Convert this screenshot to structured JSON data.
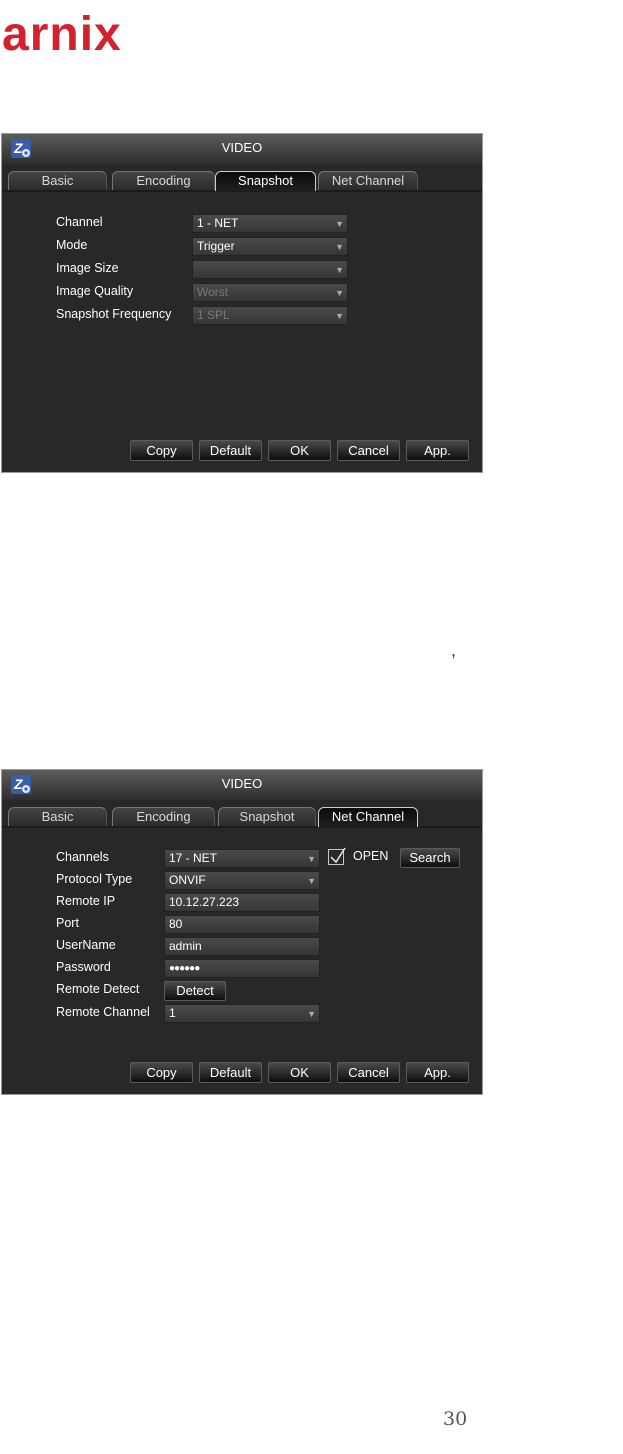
{
  "logo": "arnix",
  "page_number": "30",
  "stray_mark": ",",
  "window1": {
    "title": "VIDEO",
    "tabs": [
      "Basic",
      "Encoding",
      "Snapshot",
      "Net Channel"
    ],
    "active_tab": "Snapshot",
    "fields": {
      "channel": {
        "label": "Channel",
        "value": "1 - NET"
      },
      "mode": {
        "label": "Mode",
        "value": "Trigger"
      },
      "image_size": {
        "label": "Image Size",
        "value": ""
      },
      "image_quality": {
        "label": "Image Quality",
        "value": "Worst"
      },
      "snapshot_frequency": {
        "label": "Snapshot Frequency",
        "value": "1 SPL"
      }
    },
    "buttons": [
      "Copy",
      "Default",
      "OK",
      "Cancel",
      "App."
    ]
  },
  "window2": {
    "title": "VIDEO",
    "tabs": [
      "Basic",
      "Encoding",
      "Snapshot",
      "Net Channel"
    ],
    "active_tab": "Net Channel",
    "fields": {
      "channels": {
        "label": "Channels",
        "value": "17 - NET"
      },
      "protocol_type": {
        "label": "Protocol Type",
        "value": "ONVIF"
      },
      "remote_ip": {
        "label": "Remote IP",
        "value": "10.12.27.223"
      },
      "port": {
        "label": "Port",
        "value": "80"
      },
      "username": {
        "label": "UserName",
        "value": "admin"
      },
      "password": {
        "label": "Password",
        "value": "●●●●●●"
      },
      "remote_detect": {
        "label": "Remote Detect"
      },
      "remote_channel": {
        "label": "Remote Channel",
        "value": "1"
      }
    },
    "open_checked": true,
    "open_label": "OPEN",
    "search_label": "Search",
    "detect_label": "Detect",
    "buttons": [
      "Copy",
      "Default",
      "OK",
      "Cancel",
      "App."
    ]
  }
}
